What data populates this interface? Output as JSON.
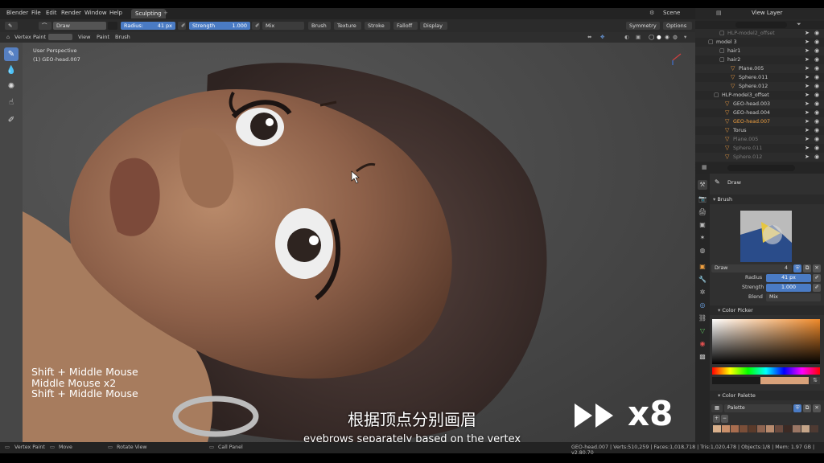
{
  "menu": {
    "items": [
      "Blender",
      "File",
      "Edit",
      "Render",
      "Window",
      "Help"
    ],
    "workspace_tab": "Sculpting",
    "add_tab": "+",
    "scene": "Scene",
    "view_layer": "View Layer"
  },
  "tool_header": {
    "brush_name": "Draw",
    "radius_label": "Radius:",
    "radius_value": "41 px",
    "strength_label": "Strength",
    "strength_value": "1.000",
    "blend": "Mix",
    "menus": [
      "Brush",
      "Texture",
      "Stroke",
      "Falloff",
      "Display"
    ],
    "symmetry": "Symmetry",
    "options": "Options"
  },
  "viewport_header": {
    "mode": "Vertex Paint",
    "menus": [
      "View",
      "Paint",
      "Brush"
    ]
  },
  "viewport": {
    "perspective": "User Perspective",
    "object": "(1) GEO-head.007"
  },
  "outliner": {
    "rows": [
      {
        "name": "HLP-model2_offset",
        "indent": 4,
        "dim": true,
        "sel": false
      },
      {
        "name": "model 3",
        "indent": 2,
        "dim": false,
        "sel": false
      },
      {
        "name": "hair1",
        "indent": 4,
        "dim": false,
        "sel": false
      },
      {
        "name": "hair2",
        "indent": 4,
        "dim": false,
        "sel": false
      },
      {
        "name": "Plane.005",
        "indent": 6,
        "dim": false,
        "sel": false
      },
      {
        "name": "Sphere.011",
        "indent": 6,
        "dim": false,
        "sel": false
      },
      {
        "name": "Sphere.012",
        "indent": 6,
        "dim": false,
        "sel": false
      },
      {
        "name": "HLP-model3_offset",
        "indent": 3,
        "dim": false,
        "sel": false
      },
      {
        "name": "GEO-head.003",
        "indent": 5,
        "dim": false,
        "sel": false
      },
      {
        "name": "GEO-head.004",
        "indent": 5,
        "dim": false,
        "sel": false
      },
      {
        "name": "GEO-head.007",
        "indent": 5,
        "dim": false,
        "sel": true
      },
      {
        "name": "Torus",
        "indent": 5,
        "dim": false,
        "sel": false
      },
      {
        "name": "Plane.005",
        "indent": 5,
        "dim": true,
        "sel": false
      },
      {
        "name": "Sphere.011",
        "indent": 5,
        "dim": true,
        "sel": false
      },
      {
        "name": "Sphere.012",
        "indent": 5,
        "dim": true,
        "sel": false
      }
    ]
  },
  "properties": {
    "tool_name": "Draw",
    "brush_section": "Brush",
    "brush_field": "Draw",
    "brush_users": "4",
    "radius_label": "Radius",
    "radius_value": "41 px",
    "strength_label": "Strength",
    "strength_value": "1.000",
    "blend_label": "Blend",
    "blend_value": "Mix",
    "color_picker": "Color Picker",
    "color_palette": "Color Palette",
    "palette_name": "Palette",
    "palette_colors": [
      "#d9b08c",
      "#c98f6a",
      "#a86d4f",
      "#7a4e38",
      "#5a3a2a",
      "#8e6450",
      "#b88b6e",
      "#6a4a3e",
      "#3c2a24",
      "#9a7664",
      "#c4a488",
      "#4e3a32"
    ]
  },
  "status_bar": {
    "left": [
      "Vertex Paint",
      "Move",
      "Rotate View",
      "Call Panel"
    ],
    "right": "GEO-head.007 | Verts:510,259 | Faces:1,018,718 | Tris:1,020,478 | Objects:1/8 | Mem: 1.97 GB | v2.80.70"
  },
  "overlay": {
    "shortcuts": [
      "Shift + Middle Mouse",
      "Middle Mouse x2",
      "Shift + Middle Mouse"
    ],
    "speed": "x8",
    "subtitle_cn": "根据顶点分别画眉",
    "subtitle_en": "eyebrows separately based on the vertex"
  }
}
